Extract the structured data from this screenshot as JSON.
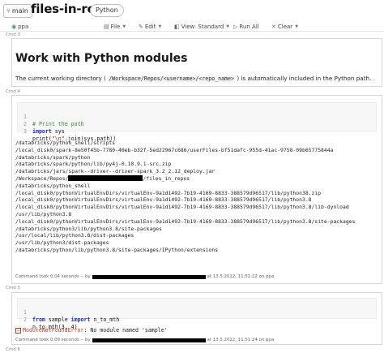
{
  "header": {
    "branch": "main",
    "title": "files-in-repos",
    "language": "Python"
  },
  "toolbar": {
    "cluster": "ppa",
    "file": "File",
    "edit": "Edit",
    "view": "View: Standard",
    "run_all": "Run All",
    "clear": "Clear"
  },
  "cells": [
    {
      "cmd": "Cmd 3",
      "heading": "Work with Python modules",
      "text_before": "The current working directory (",
      "text_code": "/Workspace/Repos/<username>/<repo_name>",
      "text_after": ") is automatically included in the Python path."
    },
    {
      "cmd": "Cmd 4",
      "code": {
        "l1_num": "1",
        "l1_comment": "# Print the path",
        "l2_num": "2",
        "l2_kw": "import",
        "l2_rest": " sys",
        "l3_num": "3",
        "l3_a": "print(",
        "l3_str": "\"\\n\"",
        "l3_b": ".join(sys.path))"
      },
      "output": [
        "/databricks/python_shell/scripts",
        "/local_disk0/spark-8e50f45b-7780-40eb-b32f-5ed22967c686/userFiles-bf51dafc-955d-41ac-9758-09b65775844a",
        "/databricks/spark/python",
        "/databricks/spark/python/lib/py4j-0.10.9.1-src.zip",
        "/databricks/jars/spark--driver--driver-spark_3.2_2.12_deploy.jar",
        "/Workspace/Repos/",
        "/databricks/python_shell",
        "/local_disk0/pythonVirtualEnvDirs/virtualEnv-9a1d1492-7b19-4169-8833-388579d96517/lib/python38.zip",
        "/local_disk0/pythonVirtualEnvDirs/virtualEnv-9a1d1492-7b19-4169-8833-388579d96517/lib/python3.8",
        "/local_disk0/pythonVirtualEnvDirs/virtualEnv-9a1d1492-7b19-4169-8833-388579d96517/lib/python3.8/lib-dynload",
        "/usr/lib/python3.8",
        "/local_disk0/pythonVirtualEnvDirs/virtualEnv-9a1d1492-7b19-4169-8833-388579d96517/lib/python3.8/site-packages",
        "/databricks/python3/lib/python3.8/site-packages",
        "/usr/local/lib/python3.8/dist-packages",
        "/usr/lib/python3/dist-packages",
        "/databricks/python/lib/python3.8/site-packages/IPython/extensions"
      ],
      "repo_suffix": "/files_in_repos",
      "took_before": "Command took 0.04 seconds -- by",
      "took_after": "at 13.5.2022, 11:51:22 on ppa"
    },
    {
      "cmd": "Cmd 5",
      "code": {
        "l1_num": "1",
        "l1_kw1": "from",
        "l1_mid": " sample ",
        "l1_kw2": "import",
        "l1_rest": " n_to_mth",
        "l2_num": "2",
        "l2_text": "n_to_mth(3, 4)"
      },
      "error_name": "ModuleNotFoundError",
      "error_msg": ": No module named 'sample'",
      "took_before": "Command took 0.09 seconds -- by",
      "took_after": "at 13.5.2022, 11:51:24 on ppa"
    },
    {
      "cmd": "Cmd 6"
    }
  ],
  "colors": {
    "error": "#c0392b",
    "keyword": "#1a2aa8",
    "comment": "#3a8a3a",
    "string": "#a31515"
  }
}
